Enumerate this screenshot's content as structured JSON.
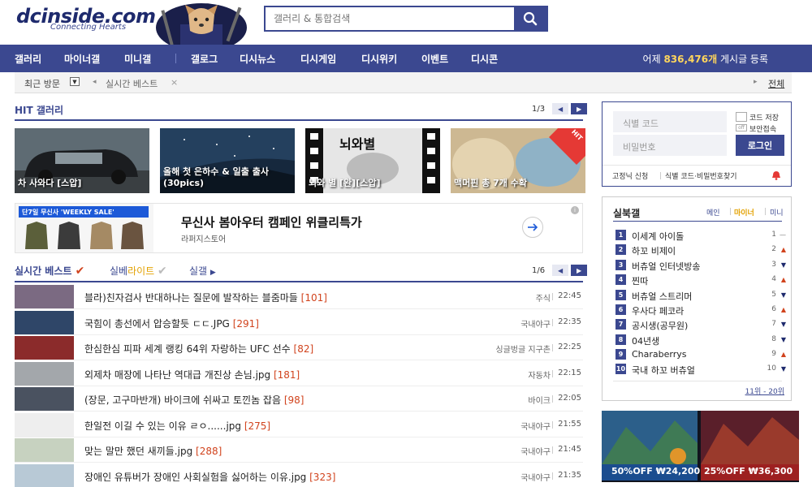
{
  "header": {
    "logo": "dcinside.com",
    "tagline": "Connecting Hearts",
    "search_placeholder": "갤러리 & 통합검색"
  },
  "nav": {
    "items": [
      "갤러리",
      "마이너갤",
      "미니갤",
      "갤로그",
      "디시뉴스",
      "디시게임",
      "디시위키",
      "이벤트",
      "디시콘"
    ],
    "stat_prefix": "어제",
    "stat_value": "836,476개",
    "stat_suffix": "게시글 등록"
  },
  "recent": {
    "label": "최근 방문",
    "item": "실시간 베스트",
    "close": "×",
    "all": "전체"
  },
  "hit": {
    "title": "HIT 갤러리",
    "page": "1/3",
    "cards": [
      {
        "caption": "차 사와다 [스압]"
      },
      {
        "caption": "올해 첫 은하수 & 일출 출사 (30pics)"
      },
      {
        "caption": "뇌와 별 [완][스압]",
        "image_text": "뇌와별"
      },
      {
        "caption": "맥머핀 총 7개 수확",
        "badge": "HIT"
      }
    ]
  },
  "ad_banner": {
    "small_title": "단7일 무신사 'WEEKLY SALE'",
    "headline": "무신사 봄아우터 캠페인 위클리특가",
    "sub": "라퍼지스토어",
    "info": "i"
  },
  "live": {
    "tabs": [
      "실시간 베스트",
      "실베",
      "라이트",
      "실갤"
    ],
    "page": "1/6",
    "posts": [
      {
        "title": "블라)친자검사 반대하나는 질문에 발작하는 블줌마들",
        "count": "[101]",
        "gallery": "주식",
        "time": "22:45"
      },
      {
        "title": "국힘이 총선에서 압승할듯 ㄷㄷ.JPG",
        "count": "[291]",
        "gallery": "국내야구",
        "time": "22:35"
      },
      {
        "title": "한심한심 피파 세계 랭킹 64위 자랑하는 UFC 선수",
        "count": "[82]",
        "gallery": "싱글벙글 지구촌",
        "time": "22:25"
      },
      {
        "title": "외제차 매장에 나타난 역대급 개진상 손님.jpg",
        "count": "[181]",
        "gallery": "자동차",
        "time": "22:15"
      },
      {
        "title": "(장문, 고구마반개) 바이크에 쉬싸고 토낀놈 잡음",
        "count": "[98]",
        "gallery": "바이크",
        "time": "22:05"
      },
      {
        "title": "한일전 이길 수 있는 이유 ㄹㅇ......jpg",
        "count": "[275]",
        "gallery": "국내야구",
        "time": "21:55"
      },
      {
        "title": "맞는 말만 했던 새끼들.jpg",
        "count": "[288]",
        "gallery": "국내야구",
        "time": "21:45"
      },
      {
        "title": "장애인 유튜버가 장애인 사회실험을 싫어하는 이유.jpg",
        "count": "[323]",
        "gallery": "국내야구",
        "time": "21:35"
      }
    ]
  },
  "login": {
    "id_placeholder": "식별 코드",
    "pw_placeholder": "비밀번호",
    "save_label": "코드 저장",
    "secure_label": "보안접속",
    "off": "off",
    "button": "로그인",
    "fixed_nick": "고정닉 신청",
    "find": "식별 코드·비밀번호찾기"
  },
  "realtime": {
    "title": "실북갤",
    "tabs": [
      "메인",
      "마이너",
      "미니"
    ],
    "footer": "11위 - 20위",
    "items": [
      {
        "rank": "1",
        "name": "이세계 아이돌",
        "change": "1",
        "trend": "same"
      },
      {
        "rank": "2",
        "name": "하꼬 비제이",
        "change": "2",
        "trend": "up"
      },
      {
        "rank": "3",
        "name": "버츄얼 인터넷방송",
        "change": "3",
        "trend": "down"
      },
      {
        "rank": "4",
        "name": "찐따",
        "change": "4",
        "trend": "up"
      },
      {
        "rank": "5",
        "name": "버츄얼 스트리머",
        "change": "5",
        "trend": "down"
      },
      {
        "rank": "6",
        "name": "우사다 페코라",
        "change": "6",
        "trend": "up"
      },
      {
        "rank": "7",
        "name": "공시생(공무원)",
        "change": "7",
        "trend": "down"
      },
      {
        "rank": "8",
        "name": "04년생",
        "change": "8",
        "trend": "down"
      },
      {
        "rank": "9",
        "name": "Charaberrys",
        "change": "9",
        "trend": "up"
      },
      {
        "rank": "10",
        "name": "국내 하꼬 버츄얼",
        "change": "10",
        "trend": "down"
      }
    ]
  },
  "ad_game": {
    "left_discount": "50%OFF",
    "left_price": "₩24,200",
    "right_discount": "25%OFF",
    "right_price": "₩36,300"
  },
  "colors": {
    "brand": "#3b4890",
    "accent": "#d1431d",
    "up": "#d1431d",
    "down": "#1e2a6d"
  }
}
